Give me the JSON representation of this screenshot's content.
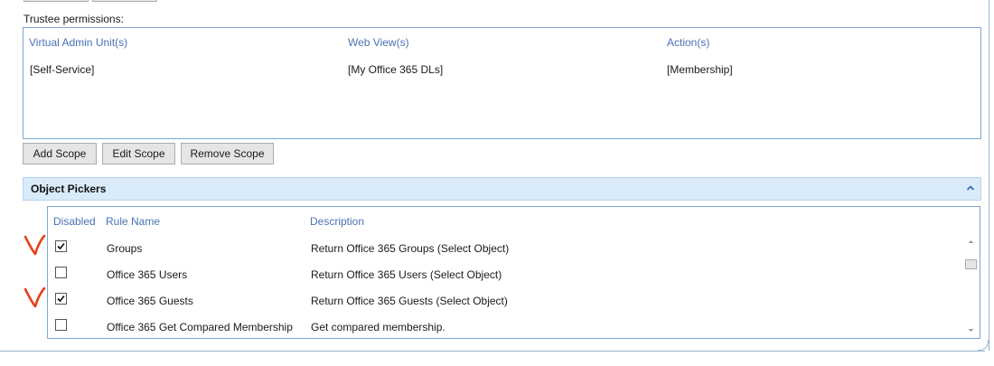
{
  "trustee": {
    "label": "Trustee permissions:",
    "columns": [
      "Virtual Admin Unit(s)",
      "Web View(s)",
      "Action(s)"
    ],
    "rows": [
      [
        "[Self-Service]",
        "[My Office 365 DLs]",
        "[Membership]"
      ]
    ]
  },
  "scope_buttons": {
    "add": "Add Scope",
    "edit": "Edit Scope",
    "remove": "Remove Scope"
  },
  "object_pickers": {
    "title": "Object Pickers",
    "collapse_icon": "chevron-up-icon",
    "columns": {
      "disabled": "Disabled",
      "rule_name": "Rule Name",
      "description": "Description"
    },
    "rows": [
      {
        "disabled": true,
        "rule_name": "Groups",
        "description": "Return Office 365 Groups (Select Object)"
      },
      {
        "disabled": false,
        "rule_name": "Office 365 Users",
        "description": "Return Office 365 Users (Select Object)"
      },
      {
        "disabled": true,
        "rule_name": "Office 365 Guests",
        "description": "Return Office 365 Guests (Select Object)"
      },
      {
        "disabled": false,
        "rule_name": "Office 365 Get Compared Membership",
        "description": "Get compared membership."
      }
    ]
  },
  "annotation_color": "#e8401c",
  "accent_header_color": "#4a72b5"
}
